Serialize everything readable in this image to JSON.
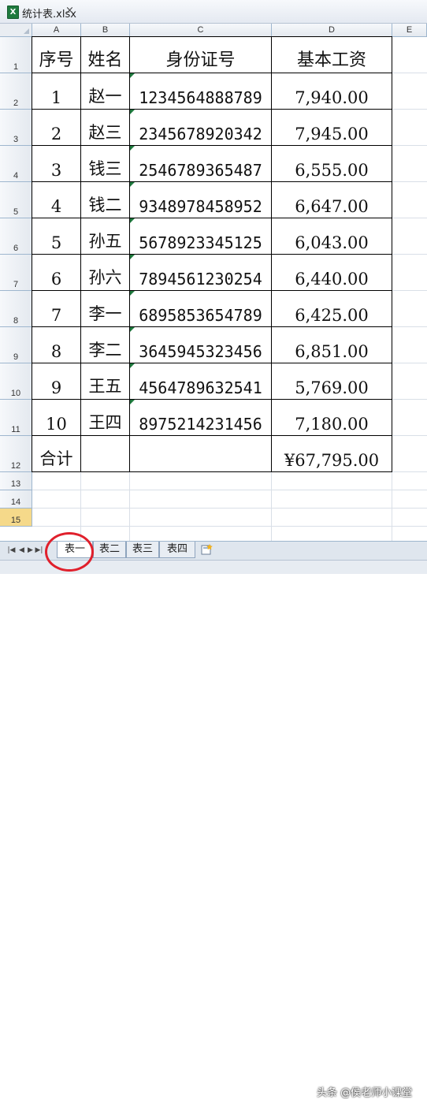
{
  "window": {
    "title": "统计表.xlsx",
    "close_glyph": "×"
  },
  "columns": [
    "A",
    "B",
    "C",
    "D",
    "E"
  ],
  "rows": [
    "1",
    "2",
    "3",
    "4",
    "5",
    "6",
    "7",
    "8",
    "9",
    "10",
    "11",
    "12",
    "13",
    "14",
    "15"
  ],
  "table": {
    "headers": [
      "序号",
      "姓名",
      "身份证号",
      "基本工资"
    ],
    "records": [
      {
        "no": "1",
        "name": "赵一",
        "id": "1234564888789",
        "salary": "7,940.00"
      },
      {
        "no": "2",
        "name": "赵三",
        "id": "2345678920342",
        "salary": "7,945.00"
      },
      {
        "no": "3",
        "name": "钱三",
        "id": "2546789365487",
        "salary": "6,555.00"
      },
      {
        "no": "4",
        "name": "钱二",
        "id": "9348978458952",
        "salary": "6,647.00"
      },
      {
        "no": "5",
        "name": "孙五",
        "id": "5678923345125",
        "salary": "6,043.00"
      },
      {
        "no": "6",
        "name": "孙六",
        "id": "7894561230254",
        "salary": "6,440.00"
      },
      {
        "no": "7",
        "name": "李一",
        "id": "6895853654789",
        "salary": "6,425.00"
      },
      {
        "no": "8",
        "name": "李二",
        "id": "3645945323456",
        "salary": "6,851.00"
      },
      {
        "no": "9",
        "name": "王五",
        "id": "4564789632541",
        "salary": "5,769.00"
      },
      {
        "no": "10",
        "name": "王四",
        "id": "8975214231456",
        "salary": "7,180.00"
      }
    ],
    "total_label": "合计",
    "total_value": "¥67,795.00"
  },
  "sheet_tabs": [
    "表一",
    "表二",
    "表三",
    "表四"
  ],
  "active_tab": "表一",
  "watermark": "头条 @侯老师小课堂",
  "colors": {
    "active_row": "#f5d98a",
    "annotation_circle": "#e0202c",
    "excel_green": "#1f7a3e"
  }
}
